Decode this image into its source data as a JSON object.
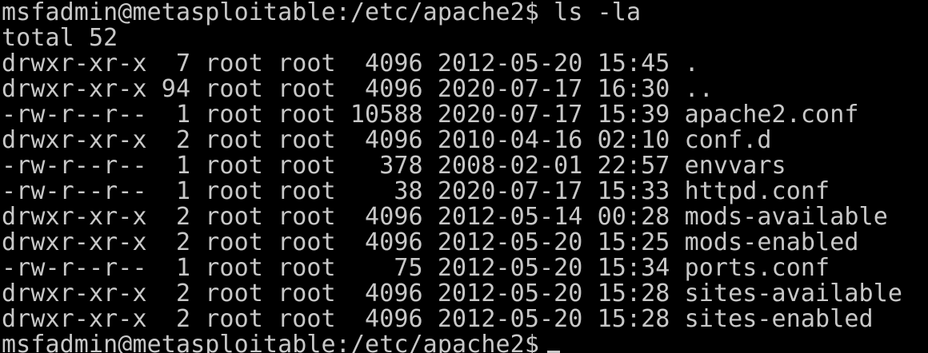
{
  "terminal": {
    "colors": {
      "background": "#000000",
      "foreground": "#c8c8c8"
    },
    "prompt": "msfadmin@metasploitable:/etc/apache2$",
    "command": "ls -la",
    "total_line": "total 52",
    "entries": [
      "drwxr-xr-x  7 root root  4096 2012-05-20 15:45 .",
      "drwxr-xr-x 94 root root  4096 2020-07-17 16:30 ..",
      "-rw-r--r--  1 root root 10588 2020-07-17 15:39 apache2.conf",
      "drwxr-xr-x  2 root root  4096 2010-04-16 02:10 conf.d",
      "-rw-r--r--  1 root root   378 2008-02-01 22:57 envvars",
      "-rw-r--r--  1 root root    38 2020-07-17 15:33 httpd.conf",
      "drwxr-xr-x  2 root root  4096 2012-05-14 00:28 mods-available",
      "drwxr-xr-x  2 root root  4096 2012-05-20 15:25 mods-enabled",
      "-rw-r--r--  1 root root    75 2012-05-20 15:34 ports.conf",
      "drwxr-xr-x  2 root root  4096 2012-05-20 15:28 sites-available",
      "drwxr-xr-x  2 root root  4096 2012-05-20 15:28 sites-enabled"
    ],
    "final_prompt": "msfadmin@metasploitable:/etc/apache2$"
  }
}
